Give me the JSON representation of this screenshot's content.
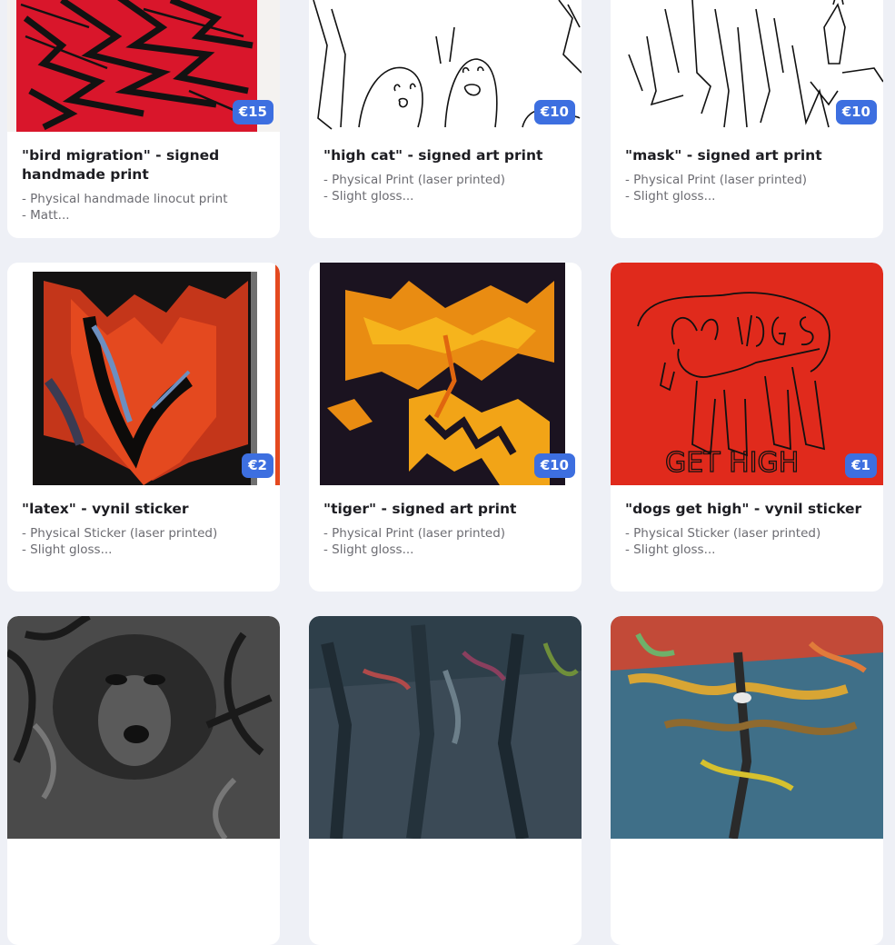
{
  "products": [
    {
      "title": "\"bird migration\" - signed handmade print",
      "price": "€15",
      "desc1": "- Physical handmade linocut print",
      "desc2": "- Matt..."
    },
    {
      "title": "\"high cat\" - signed art print",
      "price": "€10",
      "desc1": "- Physical Print (laser printed)",
      "desc2": "- Slight gloss..."
    },
    {
      "title": "\"mask\" - signed art print",
      "price": "€10",
      "desc1": "- Physical Print (laser printed)",
      "desc2": "- Slight gloss..."
    },
    {
      "title": "\"latex\" - vynil sticker",
      "price": "€2",
      "desc1": "- Physical Sticker (laser printed)",
      "desc2": "- Slight gloss..."
    },
    {
      "title": "\"tiger\" - signed art print",
      "price": "€10",
      "desc1": "- Physical Print (laser printed)",
      "desc2": "- Slight gloss..."
    },
    {
      "title": "\"dogs get high\" - vynil sticker",
      "price": "€1",
      "desc1": "- Physical Sticker (laser printed)",
      "desc2": "- Slight gloss..."
    },
    {
      "title": "",
      "price": "",
      "desc1": "",
      "desc2": ""
    },
    {
      "title": "",
      "price": "",
      "desc1": "",
      "desc2": ""
    },
    {
      "title": "",
      "price": "",
      "desc1": "",
      "desc2": ""
    }
  ],
  "artwork_text": {
    "dogs_line1": "DOGS",
    "dogs_line2": "GET HIGH"
  },
  "colors": {
    "price_badge": "#3d6fe0",
    "page_bg": "#eef0f6",
    "card_bg": "#ffffff"
  }
}
